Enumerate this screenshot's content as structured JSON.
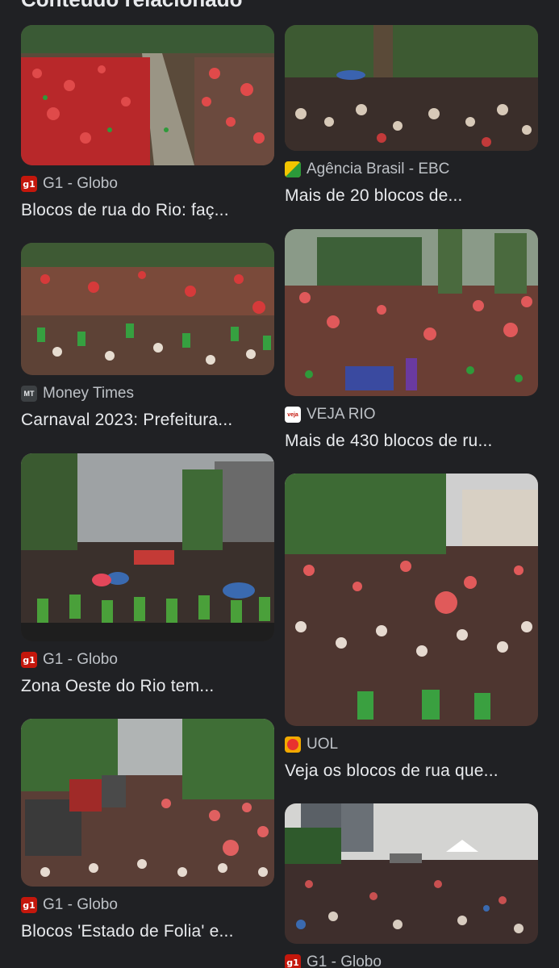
{
  "section": {
    "title": "Conteúdo relacionado"
  },
  "colors": {
    "background": "#202124",
    "text_primary": "#e8eaed",
    "text_secondary": "#bdc1c6",
    "g1_red": "#c4170c",
    "ebc_yellow": "#f2c500",
    "uol_orange": "#f2a900"
  },
  "cards": [
    {
      "source": "G1 - Globo",
      "favicon": "g1-favicon",
      "favicon_text": "g1",
      "title": "Blocos de rua do Rio: faç...",
      "image": "crowd-red-umbrellas-photo"
    },
    {
      "source": "Agência Brasil - EBC",
      "favicon": "ebc-favicon",
      "favicon_text": "",
      "title": "Mais de 20 blocos de...",
      "image": "crowd-park-photo"
    },
    {
      "source": "Money Times",
      "favicon": "money-times-favicon",
      "favicon_text": "MT",
      "title": "Carnaval 2023: Prefeitura...",
      "image": "crowd-avenue-photo"
    },
    {
      "source": "VEJA RIO",
      "favicon": "veja-rio-favicon",
      "favicon_text": "veja",
      "title": "Mais de 430 blocos de ru...",
      "image": "crowd-palm-trees-photo"
    },
    {
      "source": "G1 - Globo",
      "favicon": "g1-favicon",
      "favicon_text": "g1",
      "title": "Zona Oeste do Rio tem...",
      "image": "crowd-police-line-photo"
    },
    {
      "source": "UOL",
      "favicon": "uol-favicon",
      "favicon_text": "",
      "title": "Veja os blocos de rua que...",
      "image": "crowd-trees-photo"
    },
    {
      "source": "G1 - Globo",
      "favicon": "g1-favicon",
      "favicon_text": "g1",
      "title": "Blocos 'Estado de Folia' e...",
      "image": "crowd-trucks-photo"
    },
    {
      "source": "G1 - Globo",
      "favicon": "g1-favicon",
      "favicon_text": "g1",
      "title": "",
      "image": "crowd-skyline-photo"
    }
  ]
}
